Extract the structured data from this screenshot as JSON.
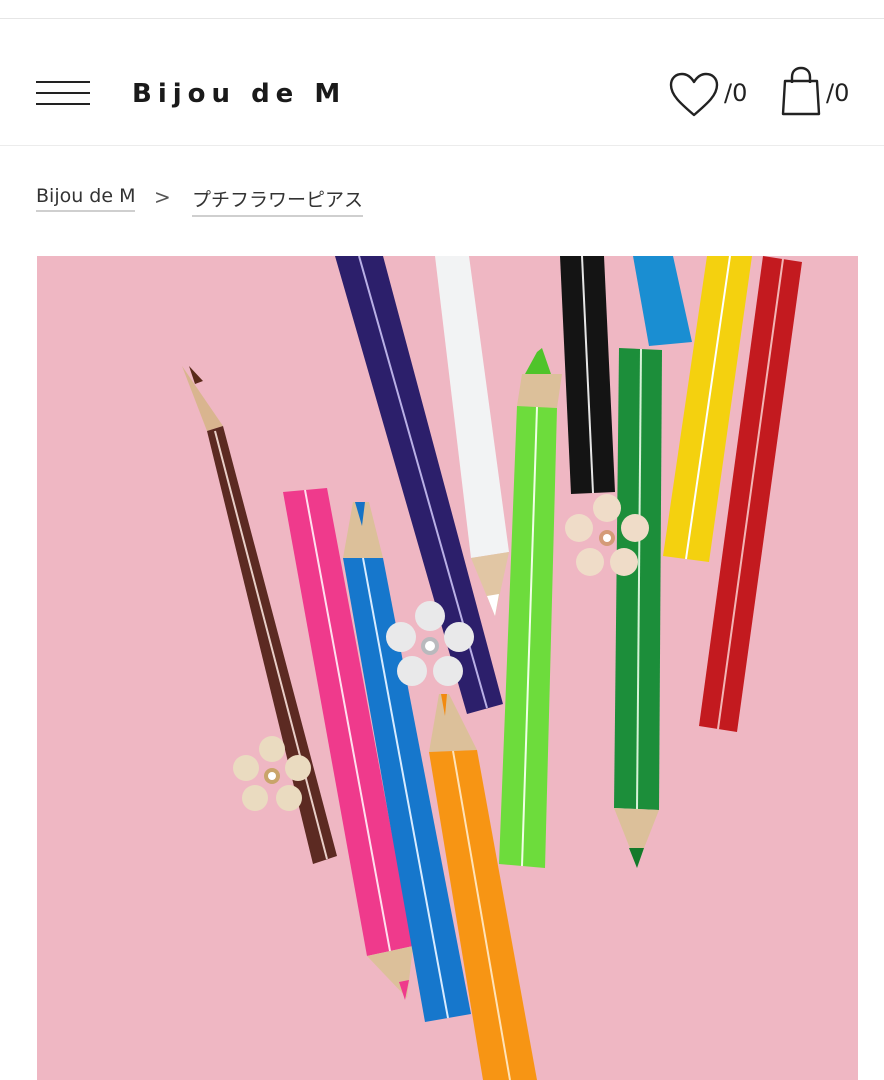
{
  "header": {
    "brand": "Bijou de M",
    "favorites_count": "/0",
    "cart_count": "/0",
    "menu_icon": "hamburger-menu-icon",
    "favorites_icon": "heart-icon",
    "cart_icon": "shopping-bag-icon"
  },
  "breadcrumb": {
    "home": "Bijou de M",
    "separator": ">",
    "current": "プチフラワーピアス"
  },
  "product_image": {
    "description_icon": "product-photo",
    "background_color": "#efb7c3"
  }
}
